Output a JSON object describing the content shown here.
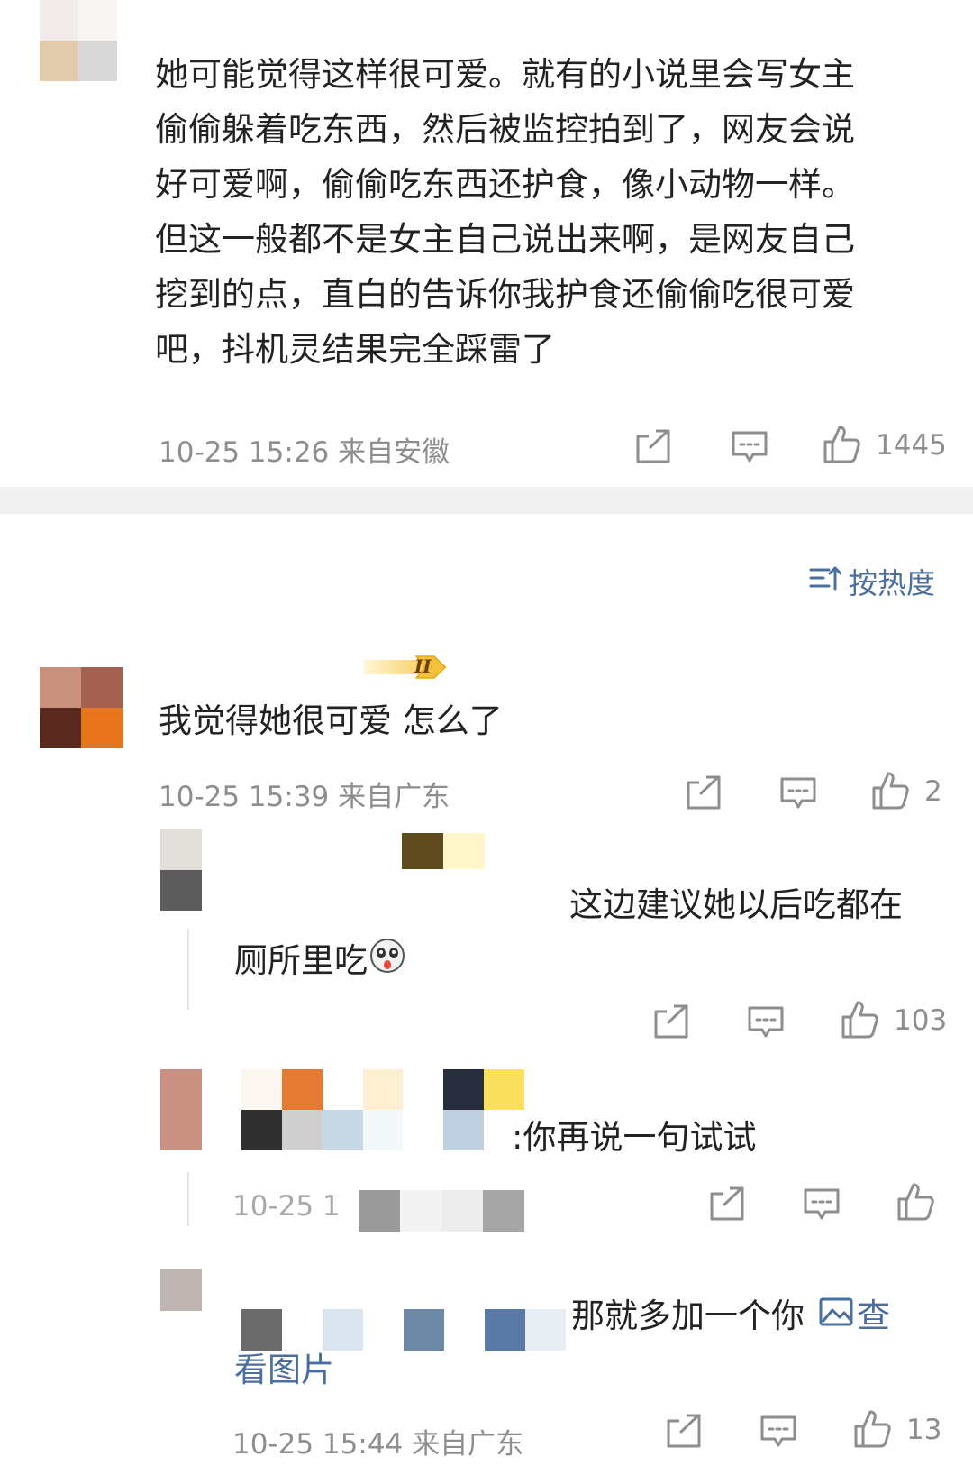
{
  "top_comment": {
    "text": "她可能觉得这样很可爱。就有的小说里会写女主偷偷躲着吃东西，然后被监控拍到了，网友会说好可爱啊，偷偷吃东西还护食，像小动物一样。但这一般都不是女主自己说出来啊，是网友自己挖到的点，直白的告诉你我护食还偷偷吃很可爱吧，抖机灵结果完全踩雷了",
    "lines": [
      "她可能觉得这样很可爱。就有的小说里会写女主",
      "偷偷躲着吃东西，然后被监控拍到了，网友会说",
      "好可爱啊，偷偷吃东西还护食，像小动物一样。",
      "但这一般都不是女主自己说出来啊，是网友自己",
      "挖到的点，直白的告诉你我护食还偷偷吃很可爱",
      "吧，抖机灵结果完全踩雷了"
    ],
    "meta": "10-25 15:26  来自安徽",
    "likes": "1445"
  },
  "sort": {
    "label": "按热度",
    "icon": "sort-icon"
  },
  "badge": {
    "text": "II",
    "color": "#f5c13a"
  },
  "comment": {
    "text": "我觉得她很可爱 怎么了",
    "meta": "10-25 15:39  来自广东",
    "likes": "2"
  },
  "replies": [
    {
      "text_line1": "这边建议她以后吃都在",
      "text_line2": "厕所里吃",
      "emoji": "doge-emoji",
      "likes": "103"
    },
    {
      "text": ":你再说一句试试",
      "meta_partial": "10-25 1",
      "likes": ""
    },
    {
      "text_line1": "那就多加一个你",
      "link_prefix": "查",
      "link_line2": "看图片",
      "link_icon": "image-icon",
      "meta": "10-25 15:44  来自广东",
      "likes": "13"
    }
  ],
  "icons": {
    "share": "share-icon",
    "comment": "comment-icon",
    "like": "like-icon"
  },
  "colors": {
    "link": "#4a6ea0",
    "meta_gray": "#8e8e8e",
    "divider": "#f0f0f0"
  }
}
